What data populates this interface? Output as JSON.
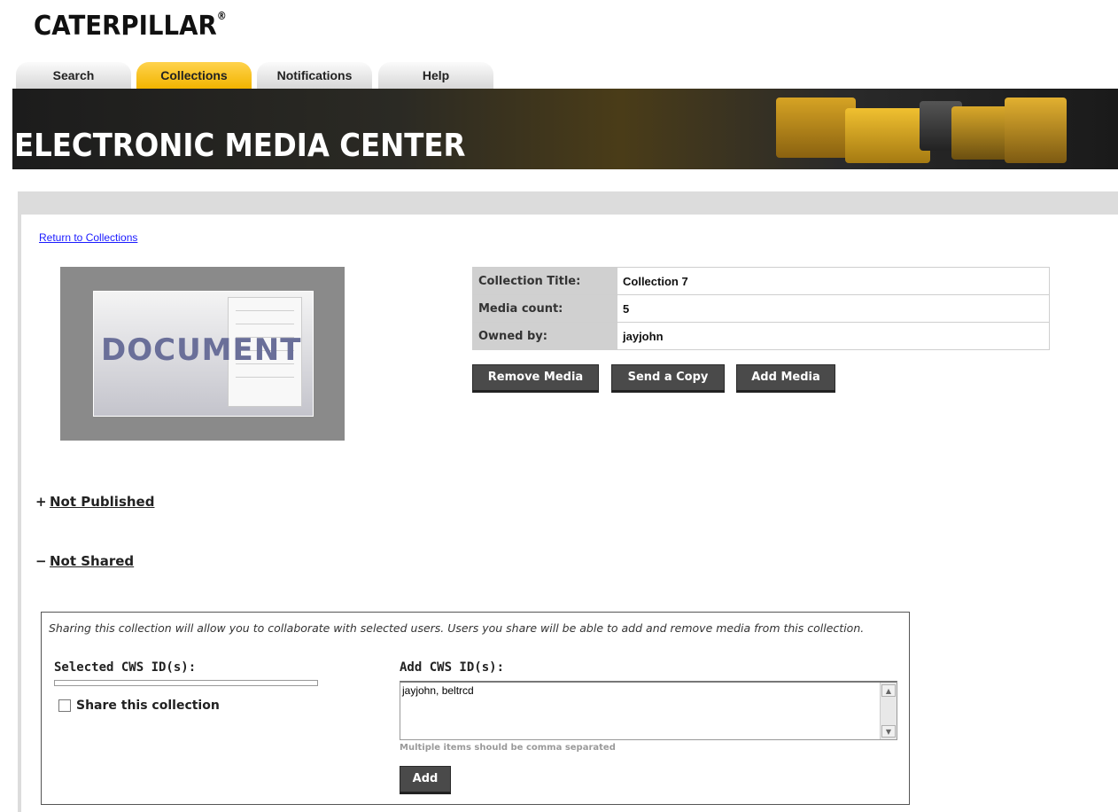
{
  "brand": {
    "logo_text": "CATERPILLAR",
    "logo_mark": "®",
    "banner_title": "ELECTRONIC MEDIA CENTER"
  },
  "tabs": [
    {
      "label": "Search",
      "active": false
    },
    {
      "label": "Collections",
      "active": true
    },
    {
      "label": "Notifications",
      "active": false
    },
    {
      "label": "Help",
      "active": false
    }
  ],
  "nav": {
    "return_link": "Return to Collections"
  },
  "thumbnail": {
    "word": "DOCUMENT"
  },
  "collection": {
    "rows": [
      {
        "key": "Collection Title:",
        "value": "Collection 7"
      },
      {
        "key": "Media count:",
        "value": "5"
      },
      {
        "key": "Owned by:",
        "value": "jayjohn"
      }
    ]
  },
  "actions": {
    "remove_media": "Remove Media",
    "send_copy": "Send a Copy",
    "add_media": "Add Media"
  },
  "sections": {
    "published": {
      "sign": "+",
      "label": "Not Published"
    },
    "shared": {
      "sign": "−",
      "label": "Not Shared"
    }
  },
  "sharing": {
    "description": "Sharing this collection will allow you to collaborate with selected users. Users you share will be able to add and remove media from this collection.",
    "selected_label": "Selected CWS ID(s):",
    "share_checkbox_label": "Share this collection",
    "add_label": "Add CWS ID(s):",
    "add_value": "jayjohn, beltrcd",
    "hint": "Multiple items should be comma separated",
    "add_button": "Add"
  },
  "colors": {
    "accent_tab": "#f2b400",
    "button_bg": "#4a4a4a",
    "link": "#1a1aff"
  }
}
